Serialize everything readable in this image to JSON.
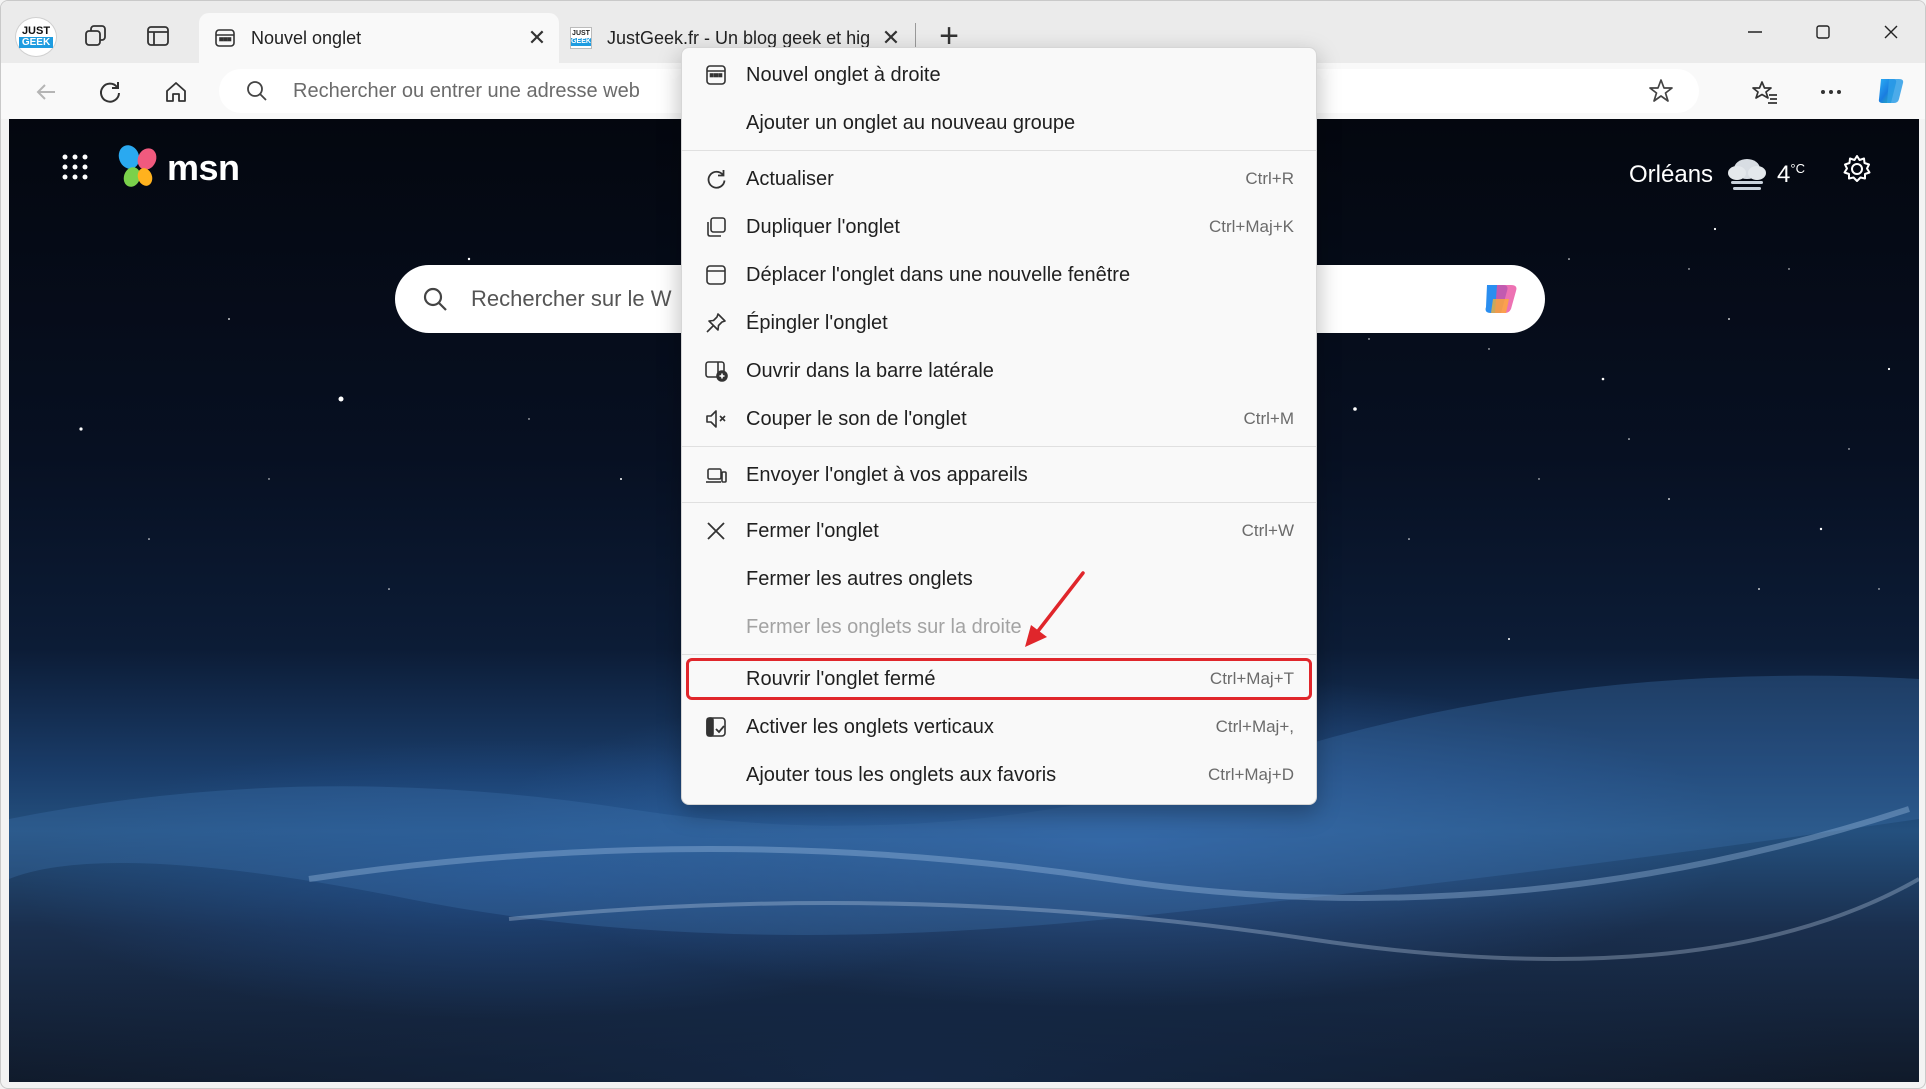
{
  "profile": {
    "line1": "JUST",
    "line2": "GEEK"
  },
  "tabs": [
    {
      "title": "Nouvel onglet",
      "active": true
    },
    {
      "title": "JustGeek.fr - Un blog geek et hig",
      "active": false,
      "favicon_line1": "JUST",
      "favicon_line2": "GEEK"
    }
  ],
  "addressbar": {
    "placeholder": "Rechercher ou entrer une adresse web"
  },
  "msn": {
    "logo_text": "msn",
    "weather": {
      "city": "Orléans",
      "temp": "4",
      "unit": "°C"
    },
    "search_placeholder": "Rechercher sur le W"
  },
  "context_menu": {
    "items": [
      {
        "label": "Nouvel onglet à droite",
        "shortcut": "",
        "icon": "new-tab-icon"
      },
      {
        "label": "Ajouter un onglet au nouveau groupe",
        "shortcut": "",
        "icon": ""
      },
      {
        "label": "Actualiser",
        "shortcut": "Ctrl+R",
        "icon": "refresh-icon"
      },
      {
        "label": "Dupliquer l'onglet",
        "shortcut": "Ctrl+Maj+K",
        "icon": "duplicate-icon"
      },
      {
        "label": "Déplacer l'onglet dans une nouvelle fenêtre",
        "shortcut": "",
        "icon": "window-icon"
      },
      {
        "label": "Épingler l'onglet",
        "shortcut": "",
        "icon": "pin-icon"
      },
      {
        "label": "Ouvrir dans la barre latérale",
        "shortcut": "",
        "icon": "sidebar-icon"
      },
      {
        "label": "Couper le son de l'onglet",
        "shortcut": "Ctrl+M",
        "icon": "mute-icon"
      },
      {
        "label": "Envoyer l'onglet à vos appareils",
        "shortcut": "",
        "icon": "devices-icon"
      },
      {
        "label": "Fermer l'onglet",
        "shortcut": "Ctrl+W",
        "icon": "close-icon"
      },
      {
        "label": "Fermer les autres onglets",
        "shortcut": "",
        "icon": ""
      },
      {
        "label": "Fermer les onglets sur la droite",
        "shortcut": "",
        "icon": "",
        "disabled": true
      },
      {
        "label": "Rouvrir l'onglet fermé",
        "shortcut": "Ctrl+Maj+T",
        "icon": "",
        "highlighted": true
      },
      {
        "label": "Activer les onglets verticaux",
        "shortcut": "Ctrl+Maj+,",
        "icon": "vertical-tabs-icon"
      },
      {
        "label": "Ajouter tous les onglets aux favoris",
        "shortcut": "Ctrl+Maj+D",
        "icon": ""
      }
    ]
  },
  "colors": {
    "highlight_border": "#e0262b",
    "arrow": "#e0262b",
    "brand_blue": "#1e9ce0"
  }
}
